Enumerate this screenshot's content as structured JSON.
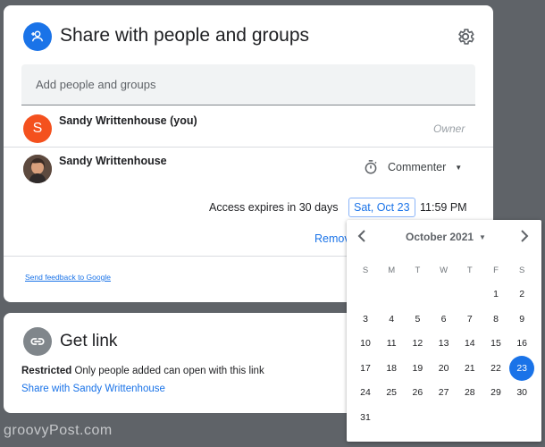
{
  "share": {
    "title": "Share with people and groups",
    "add_placeholder": "Add people and groups",
    "owner": {
      "avatar_letter": "S",
      "name": "Sandy Writtenhouse (you)",
      "role": "Owner"
    },
    "user": {
      "name": "Sandy Writtenhouse",
      "role": "Commenter"
    },
    "expiry": {
      "label": "Access expires in 30 days",
      "date": "Sat, Oct 23",
      "time": "11:59 PM"
    },
    "remove_label": "Remove",
    "feedback_label": "Send feedback to Google"
  },
  "link": {
    "title": "Get link",
    "restricted_label": "Restricted",
    "restricted_desc": " Only people added can open with this link",
    "share_with_label": "Share with Sandy Writtenhouse"
  },
  "calendar": {
    "month_label": "October 2021",
    "weekdays": [
      "S",
      "M",
      "T",
      "W",
      "T",
      "F",
      "S"
    ],
    "weeks": [
      [
        "",
        "",
        "",
        "",
        "",
        "1",
        "2"
      ],
      [
        "3",
        "4",
        "5",
        "6",
        "7",
        "8",
        "9"
      ],
      [
        "10",
        "11",
        "12",
        "13",
        "14",
        "15",
        "16"
      ],
      [
        "17",
        "18",
        "19",
        "20",
        "21",
        "22",
        "23"
      ],
      [
        "24",
        "25",
        "26",
        "27",
        "28",
        "29",
        "30"
      ],
      [
        "31",
        "",
        "",
        "",
        "",
        "",
        ""
      ]
    ],
    "selected_day": "23"
  },
  "watermark": "groovyPost.com",
  "colors": {
    "accent": "#1a73e8",
    "owner_avatar": "#f4511e",
    "link_icon_bg": "#80868b"
  },
  "icons": {
    "share": "person-add-icon",
    "settings": "gear-icon",
    "timer": "timer-icon",
    "link": "link-icon",
    "prev": "chevron-left-icon",
    "next": "chevron-right-icon"
  }
}
